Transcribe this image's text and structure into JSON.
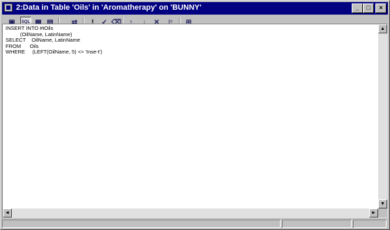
{
  "window": {
    "title": "2:Data in Table 'Oils' in 'Aromatherapy' on 'BUNNY'",
    "buttons": {
      "minimize": "_",
      "maximize": "□",
      "close": "×"
    }
  },
  "toolbar": {
    "tools": [
      {
        "name": "properties-icon",
        "glyph": "▣",
        "active": false
      },
      {
        "name": "show-sql-pane-icon",
        "glyph": "SQL",
        "active": true
      },
      {
        "name": "show-grid-pane-icon",
        "glyph": "▦",
        "active": false
      },
      {
        "name": "show-results-pane-icon",
        "glyph": "▤",
        "active": false
      },
      {
        "name": "change-query-type-icon",
        "glyph": "⇄",
        "active": false
      },
      {
        "name": "run-icon",
        "glyph": "!",
        "active": false
      },
      {
        "name": "verify-sql-icon",
        "glyph": "✓",
        "active": false
      },
      {
        "name": "remove-filter-icon",
        "glyph": "⌫",
        "active": false
      },
      {
        "name": "sort-ascending-icon",
        "glyph": "↑",
        "active": false
      },
      {
        "name": "sort-descending-icon",
        "glyph": "↓",
        "active": false
      },
      {
        "name": "clear-sort-icon",
        "glyph": "✕",
        "active": false
      },
      {
        "name": "group-by-icon",
        "glyph": "[=",
        "active": false
      },
      {
        "name": "add-table-icon",
        "glyph": "⊞",
        "active": false
      }
    ]
  },
  "editor": {
    "sql_text": "INSERT INTO #tOils\n          (OilName, LatinName)\nSELECT    OilName, LatinName\nFROM      Oils\nWHERE     (LEFT(OilName, 5) <> 'Inse-t')"
  },
  "scrollbars": {
    "up": "▲",
    "down": "▼",
    "left": "◄",
    "right": "►"
  },
  "colors": {
    "titlebar": "#000080",
    "face": "#c0c0c0",
    "editor_bg": "#ffffff"
  }
}
